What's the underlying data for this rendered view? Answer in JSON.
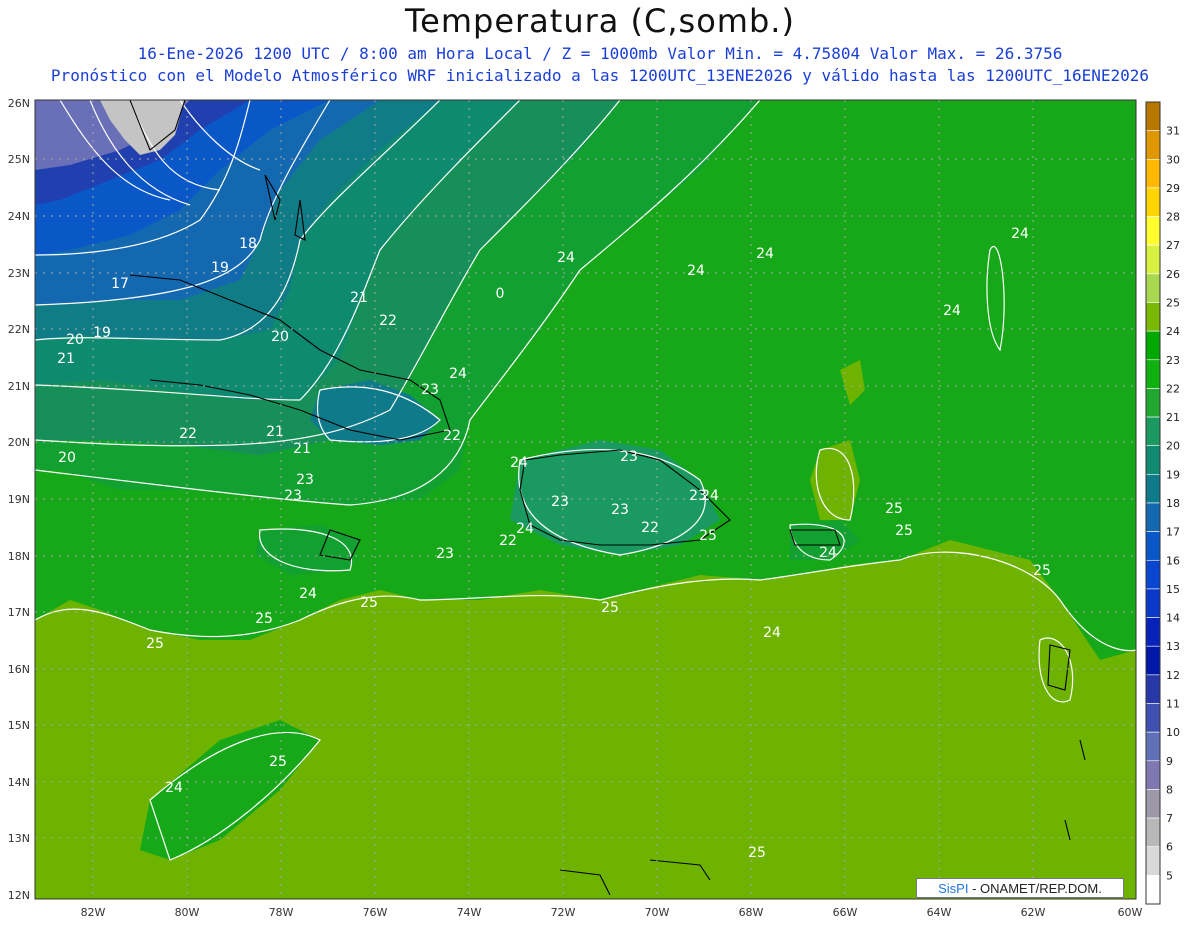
{
  "title": "Temperatura (C,somb.)",
  "subtitle_line1": "16-Ene-2026 1200 UTC / 8:00 am Hora Local / Z = 1000mb   Valor Min. = 4.75804  Valor Max. = 26.3756",
  "subtitle_line2": "Pronóstico con el Modelo Atmosférico WRF inicializado a las 1200UTC_13ENE2026 y válido hasta las  1200UTC_16ENE2026",
  "credit": {
    "brand": "SisPI",
    "rest": " - ONAMET/REP.DOM."
  },
  "axes": {
    "lat_labels": [
      "26N",
      "25N",
      "24N",
      "23N",
      "22N",
      "21N",
      "20N",
      "19N",
      "18N",
      "17N",
      "16N",
      "15N",
      "14N",
      "13N",
      "12N"
    ],
    "lon_labels": [
      "82W",
      "80W",
      "78W",
      "76W",
      "74W",
      "72W",
      "70W",
      "68W",
      "66W",
      "64W",
      "62W",
      "60W"
    ]
  },
  "colorbar": {
    "labels": [
      "31",
      "30",
      "29",
      "28",
      "27",
      "26",
      "25",
      "24",
      "23",
      "22",
      "21",
      "20",
      "19",
      "18",
      "17",
      "16",
      "15",
      "14",
      "13",
      "12",
      "11",
      "10",
      "9",
      "8",
      "7",
      "6",
      "5"
    ],
    "colors": [
      "#b87800",
      "#e09800",
      "#ffb800",
      "#ffd400",
      "#ffff30",
      "#d8f040",
      "#a8d850",
      "#7ab800",
      "#00a800",
      "#10b010",
      "#20a830",
      "#1a9a60",
      "#108a70",
      "#0e7a8a",
      "#1468b0",
      "#0a58c8",
      "#0846d0",
      "#0a38c8",
      "#0622b8",
      "#0018a8",
      "#2838a8",
      "#4050b0",
      "#6070b8",
      "#8078b0",
      "#9c98a8",
      "#b8b8b8",
      "#d8d8d8",
      "#ffffff"
    ]
  },
  "contour_labels": [
    "18",
    "19",
    "17",
    "19",
    "20",
    "21",
    "20",
    "21",
    "22",
    "23",
    "24",
    "0",
    "21",
    "22",
    "23",
    "24",
    "24",
    "24",
    "24",
    "22",
    "21",
    "20",
    "23",
    "24",
    "22",
    "23",
    "23",
    "24",
    "23",
    "23",
    "22",
    "23",
    "24",
    "24",
    "24",
    "25",
    "25",
    "25",
    "24",
    "25",
    "25",
    "25",
    "25",
    "24",
    "25",
    "24",
    "25",
    "25"
  ],
  "map": {
    "fields": "Temperatura 1000mb"
  }
}
